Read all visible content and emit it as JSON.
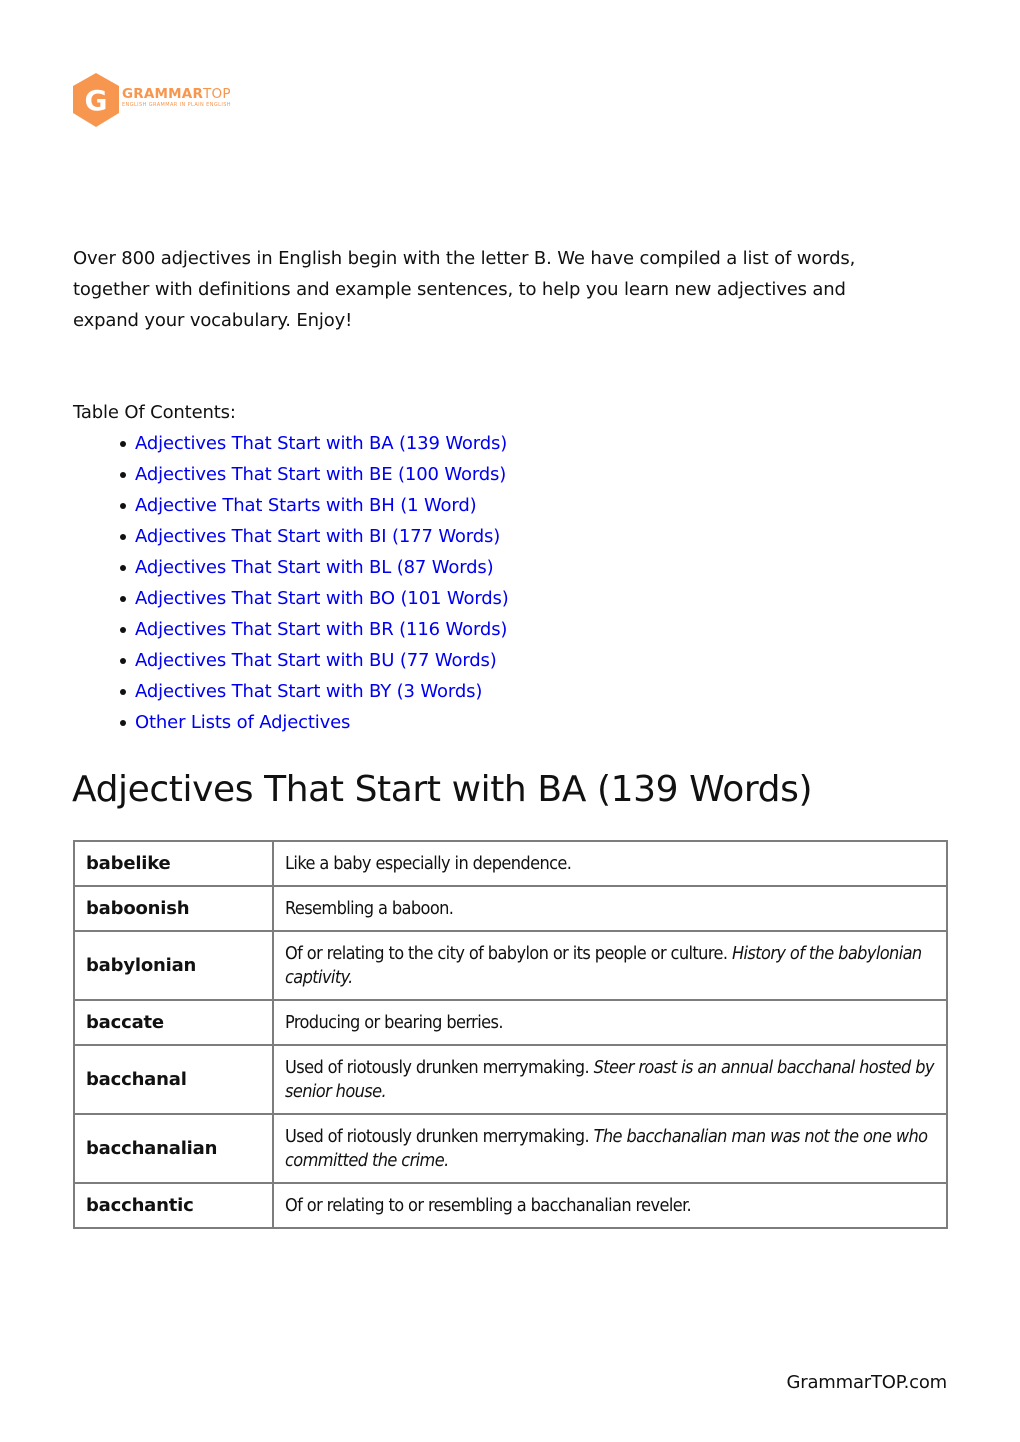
{
  "logo": {
    "letter": "G",
    "name_bold": "GRAMMAR",
    "name_light": "TOP",
    "tagline": "ENGLISH GRAMMAR IN PLAIN ENGLISH",
    "color": "#f7964f"
  },
  "intro": "Over 800 adjectives in English begin with the letter B. We have compiled a list of words, together with definitions and example sentences, to help you learn new adjectives and expand your vocabulary. Enjoy!",
  "toc": {
    "title": "Table Of Contents:",
    "items": [
      {
        "label": "Adjectives That Start with BA (139 Words)"
      },
      {
        "label": "Adjectives That Start with BE (100 Words)"
      },
      {
        "label": "Adjective That Starts with BH (1 Word)"
      },
      {
        "label": "Adjectives That Start with BI (177 Words)"
      },
      {
        "label": "Adjectives That Start with BL (87 Words)"
      },
      {
        "label": "Adjectives That Start with BO (101 Words)"
      },
      {
        "label": "Adjectives That Start with BR (116 Words)"
      },
      {
        "label": "Adjectives That Start with BU (77 Words)"
      },
      {
        "label": "Adjectives That Start with BY (3 Words)"
      },
      {
        "label": "Other Lists of Adjectives"
      }
    ],
    "link_color": "#0000ee"
  },
  "section": {
    "heading": "Adjectives That Start with BA (139 Words)",
    "rows": [
      {
        "word": "babelike",
        "definition": "Like a baby especially in dependence.",
        "example": ""
      },
      {
        "word": "baboonish",
        "definition": "Resembling a baboon.",
        "example": ""
      },
      {
        "word": "babylonian",
        "definition": "Of or relating to the city of babylon or its people or culture.",
        "example": "History of the babylonian captivity."
      },
      {
        "word": "baccate",
        "definition": "Producing or bearing berries.",
        "example": ""
      },
      {
        "word": "bacchanal",
        "definition": "Used of riotously drunken merrymaking.",
        "example": "Steer roast is an annual bacchanal hosted by senior house."
      },
      {
        "word": "bacchanalian",
        "definition": "Used of riotously drunken merrymaking.",
        "example": "The bacchanalian man was not the one who committed the crime."
      },
      {
        "word": "bacchantic",
        "definition": "Of or relating to or resembling a bacchanalian reveler.",
        "example": ""
      }
    ]
  },
  "footer": "GrammarTOP.com"
}
